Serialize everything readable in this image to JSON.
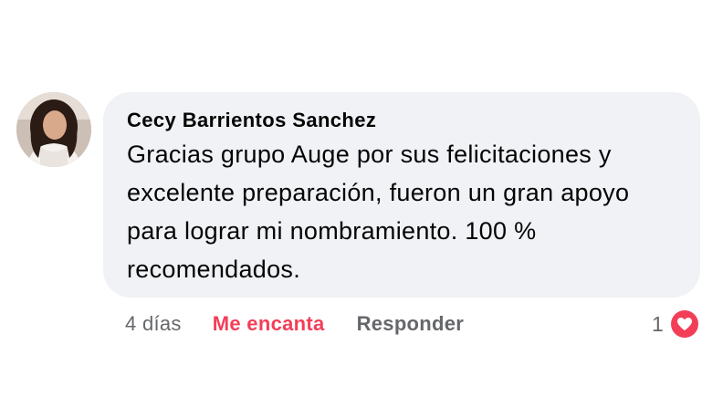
{
  "comment": {
    "author": "Cecy Barrientos Sanchez",
    "text": "Gracias grupo Auge por sus felicitaciones y excelente preparación, fueron un gran apoyo para lograr mi nombramiento. 100 % recomendados.",
    "avatar_icon": "profile-photo",
    "actions": {
      "time": "4 días",
      "reaction_label": "Me encanta",
      "reply_label": "Responder"
    },
    "reactions": {
      "count": "1",
      "icon": "love-heart-icon",
      "color": "#f33e58"
    }
  },
  "colors": {
    "bubble": "#f0f2f5",
    "text": "#050505",
    "secondary": "#65676b",
    "love": "#f33e58"
  }
}
